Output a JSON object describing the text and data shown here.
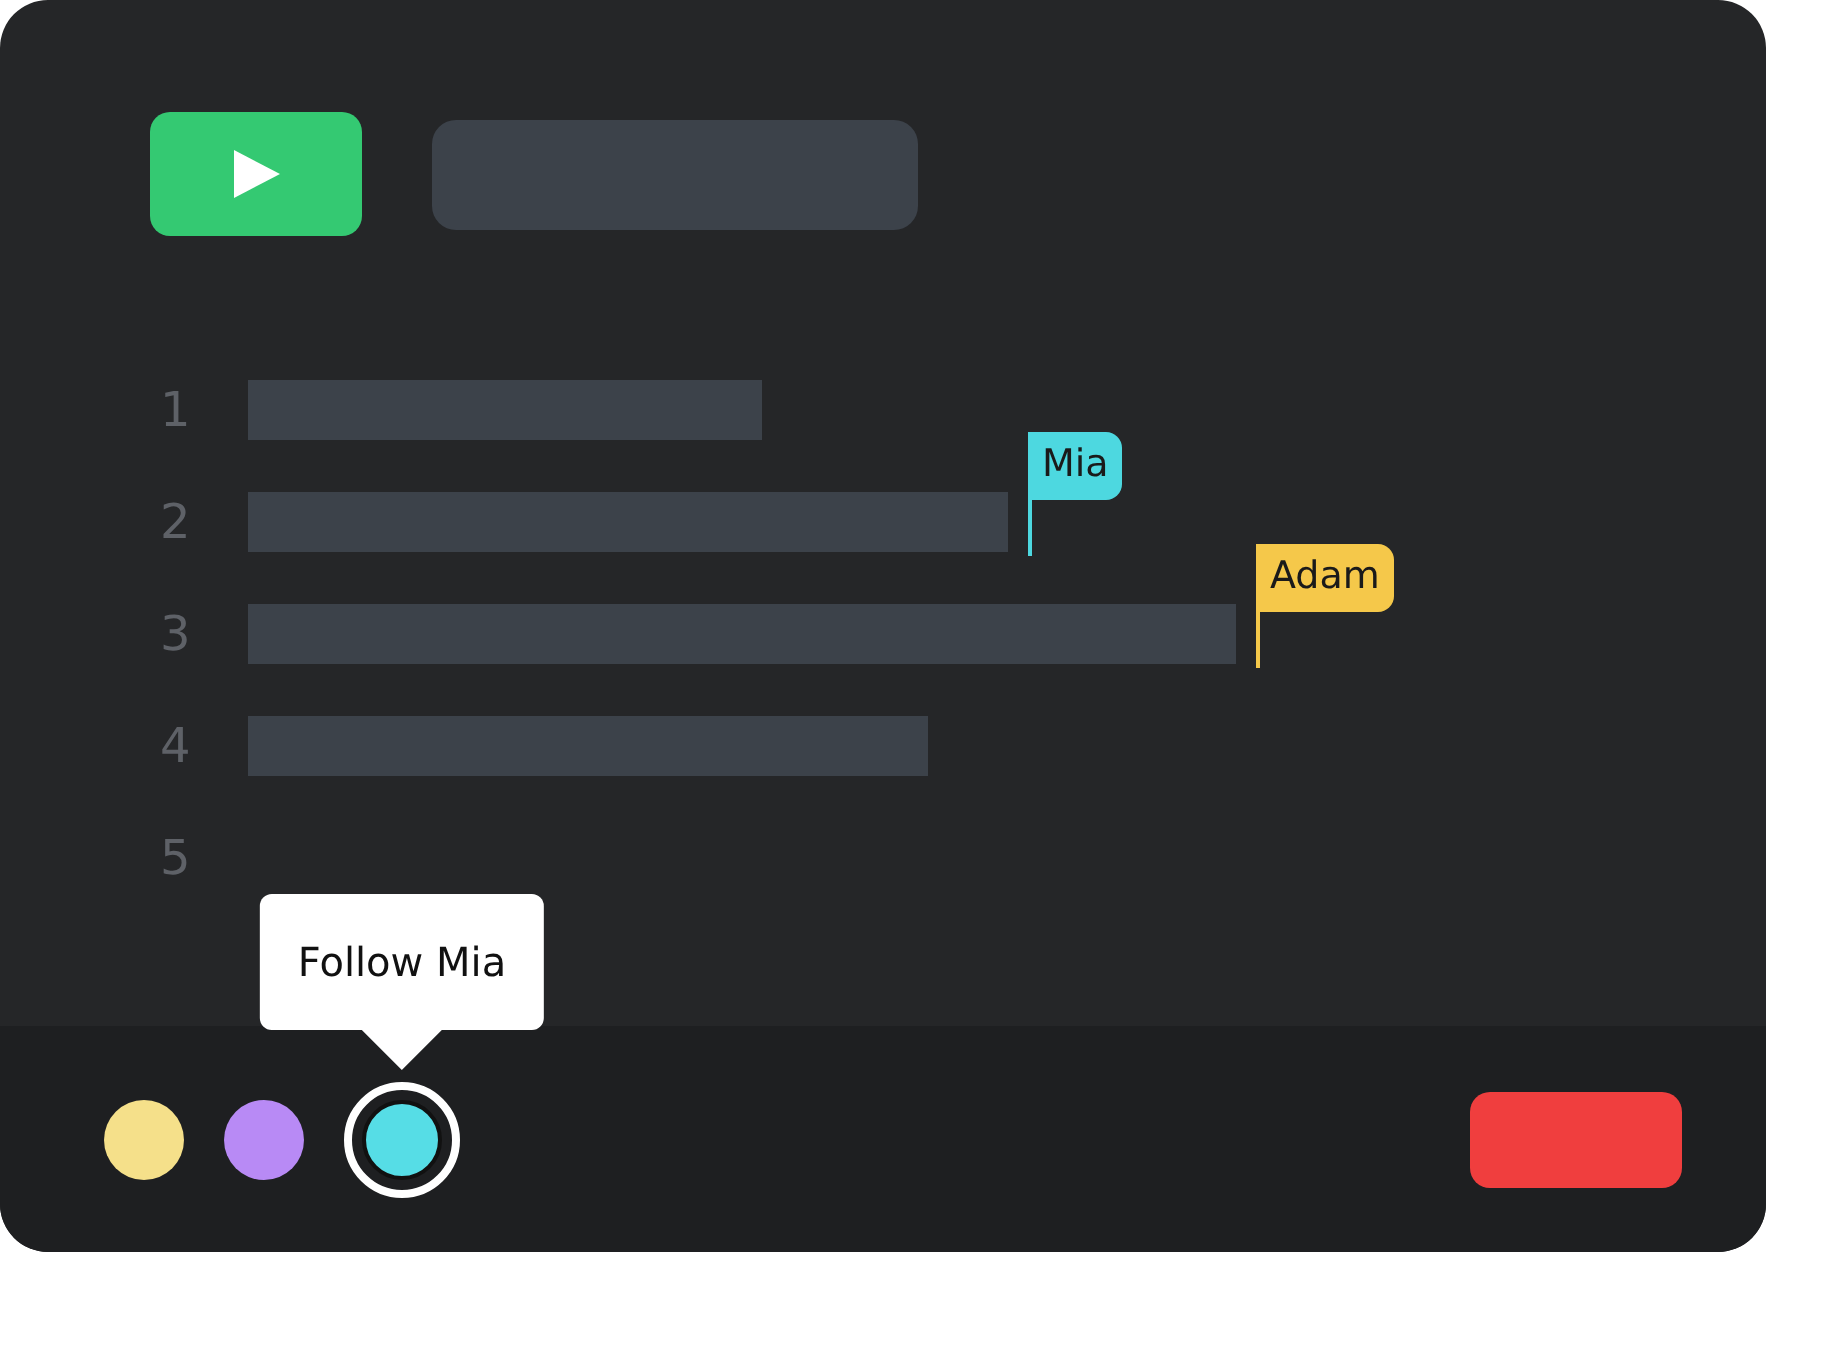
{
  "toolbar": {
    "run_button": {
      "kind": "play"
    }
  },
  "lines": [
    {
      "number": "1"
    },
    {
      "number": "2",
      "cursor": {
        "name": "Mia",
        "color": "#4dd8e0"
      }
    },
    {
      "number": "3",
      "cursor": {
        "name": "Adam",
        "color": "#f5c84a"
      }
    },
    {
      "number": "4"
    },
    {
      "number": "5"
    }
  ],
  "participants": [
    {
      "color": "#f5e08a",
      "selected": false
    },
    {
      "color": "#b88af5",
      "selected": false
    },
    {
      "color": "#56dde6",
      "selected": true,
      "tooltip": "Follow Mia"
    }
  ]
}
